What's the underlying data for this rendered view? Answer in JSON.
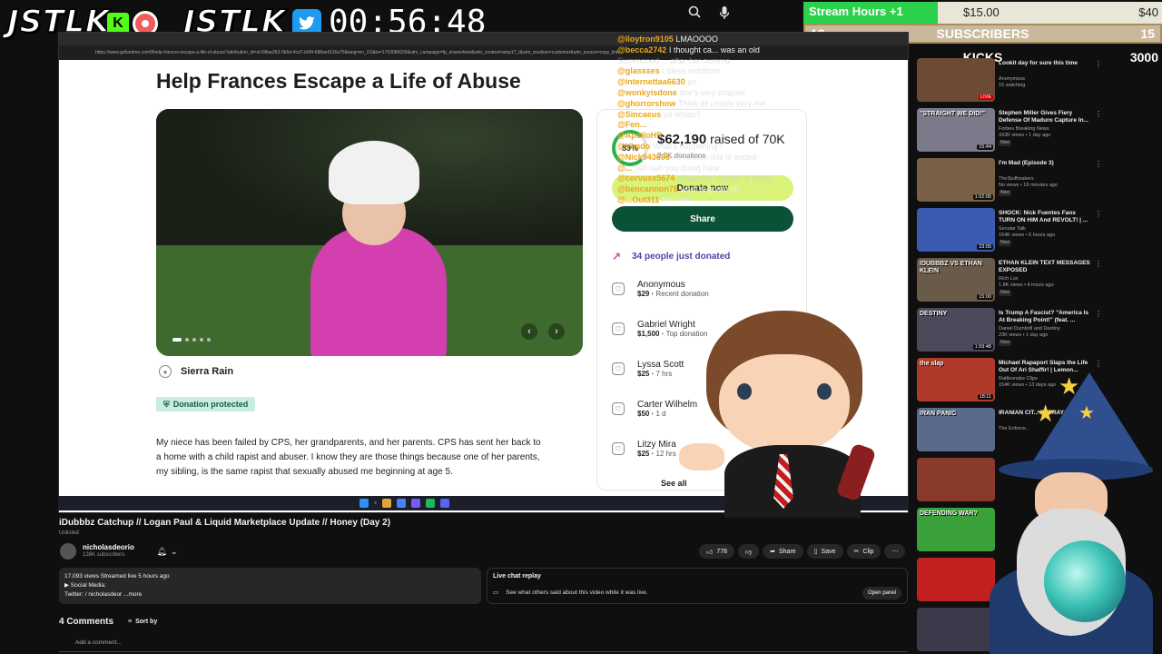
{
  "overlay": {
    "brand_left": "JSTLK",
    "brand_right": "JSTLK",
    "kick_letter": "K",
    "timer": "00:56:48",
    "goal_label": "Stream Hours +1",
    "goal_fraction": 0.375,
    "goal_current": "$15.00",
    "goal_target": "$40",
    "subs_left": "18",
    "subs_center": "SUBSCRIBERS",
    "subs_right": "15",
    "kicks_badge": "0",
    "kicks_center": "KICKS",
    "kicks_right": "3000"
  },
  "browser": {
    "url": "https://www.gofundme.com/f/help-frances-escape-a-life-of-abuse?attribution_id=sl:09faa263-0b5d-4cd7-b0f4-688ae6116a75&lang=en_US&ts=1763084206&utm_campaign=fp_sharesheet&utm_content=amp17_t&utm_medium=customer&utm_source=copy_link"
  },
  "gofundme": {
    "title": "Help Frances Escape a Life of Abuse",
    "organizer": "Sierra Rain",
    "protected_label": "Donation protected",
    "story": "My niece has been failed by CPS, her grandparents, and her parents. CPS has sent her back to a home with a child rapist and abuser. I know they are those things because one of her parents, my sibling, is the same rapist that sexually abused me beginning at age 5.",
    "progress_pct": "89%",
    "raised_amount": "$62,190",
    "raised_of": "raised of 70K",
    "donations_count": "2.9K donations",
    "donate_label": "Donate now",
    "share_label": "Share",
    "recent_label": "34 people just donated",
    "donors": [
      {
        "name": "Anonymous",
        "amount": "$29",
        "note": "Recent donation"
      },
      {
        "name": "Gabriel Wright",
        "amount": "$1,500",
        "note": "Top donation"
      },
      {
        "name": "Lyssa Scott",
        "amount": "$25",
        "note": "7 hrs"
      },
      {
        "name": "Carter Wilhelm",
        "amount": "$50",
        "note": "1 d"
      },
      {
        "name": "Litzy Mira",
        "amount": "$25",
        "note": "12 hrs"
      }
    ],
    "see_all": "See all"
  },
  "chat": [
    {
      "user": "@lloytron9105",
      "msg": "LMAOOOO",
      "dim": false
    },
    {
      "user": "@becca2742",
      "msg": "I thought ca... was an old",
      "dim": false
    },
    {
      "user": "",
      "msg": "Summoned ... after her summa",
      "dim": true
    },
    {
      "user": "@glassses",
      "msg": "I bless redditors",
      "dim": true
    },
    {
      "user": "@internettaa6630",
      "msg": "yo",
      "dim": true
    },
    {
      "user": "@wonkyisdone",
      "msg": "she's very mapset",
      "dim": true
    },
    {
      "user": "@ghorrorshow",
      "msg": "Think all mostly very me",
      "dim": true
    },
    {
      "user": "@Sincaeus",
      "msg": "yo whats?",
      "dim": true
    },
    {
      "user": "@Fen...",
      "msg": "...",
      "dim": true
    },
    {
      "user": "@ApolloHP",
      "msg": "",
      "dim": true
    },
    {
      "user": "@Vlmdo",
      "msg": "What's happening?",
      "dim": true
    },
    {
      "user": "@Nick943898",
      "msg": "no reason this is ended",
      "dim": true
    },
    {
      "user": "@...",
      "msg": "hell nah you doing hare",
      "dim": true
    },
    {
      "user": "@corvusx5674",
      "msg": "Whatever shaese of three",
      "dim": true
    },
    {
      "user": "@bencannon78",
      "msg": "what is going on",
      "dim": false
    },
    {
      "user": "@...Out311",
      "msg": "hell yea",
      "dim": false
    }
  ],
  "video": {
    "title": "iDubbbz Catchup // Logan Paul & Liquid Marketplace Update // Honey (Day 2)",
    "unlisted": "Unlisted",
    "channel": "nicholasdeorio",
    "channel_subs": "138K subscribers",
    "likes": "778",
    "share": "Share",
    "save": "Save",
    "clip": "Clip",
    "desc_line1": "17,093 views  Streamed live 5 hours ago",
    "desc_line2": "▶ Social Media:",
    "desc_line3": "Twitter:  / nicholasdeor  ...more",
    "live_replay_title": "Live chat replay",
    "live_replay_sub": "See what others said about this video while it was live.",
    "open_panel": "Open panel",
    "comments_count": "4 Comments",
    "sort_by": "Sort by",
    "add_comment": "Add a comment..."
  },
  "sidebar": [
    {
      "title": "Lookit day for sure this time",
      "meta1": "Anonymous",
      "meta2": "15 watching",
      "badge": "LIVE",
      "dur": "",
      "color": "#6d4a33"
    },
    {
      "title": "Stephen Miller Gives Fiery Defense Of Maduro Capture In...",
      "meta1": "Forbes Breaking News",
      "meta2": "333K views • 1 day ago",
      "badge": "New",
      "dur": "15:44",
      "color": "#7a7a8a"
    },
    {
      "title": "I'm Mad (Episode 3)",
      "meta1": "TheStuffmakers",
      "meta2": "No views • 19 minutes ago",
      "badge": "New",
      "dur": "1:02:05",
      "color": "#7a6045"
    },
    {
      "title": "SHOCK: Nick Fuentes Fans TURN ON HIM And REVOLT! | ...",
      "meta1": "Secular Talk",
      "meta2": "154K views • 6 hours ago",
      "badge": "New",
      "dur": "23:05",
      "color": "#3a5bb0"
    },
    {
      "title": "ETHAN KLEIN TEXT MESSAGES EXPOSED",
      "meta1": "Rich Lux",
      "meta2": "1.8K views • 4 hours ago",
      "badge": "New",
      "dur": "15:00",
      "color": "#6a5a4a"
    },
    {
      "title": "Is Trump A Fascist? \"America Is At Breaking Point!\" (feat. ...",
      "meta1": "Daniel Dumbrill and Destiny",
      "meta2": "23K views • 1 day ago",
      "badge": "New",
      "dur": "1:59:48",
      "color": "#4a4a5a"
    },
    {
      "title": "Michael Rapaport Slaps the Life Out Of Ari Shaffir! | Lemon...",
      "meta1": "Rattlesnake Clips",
      "meta2": "154K views • 13 days ago",
      "badge": "",
      "dur": "18:11",
      "color": "#b03a2a"
    },
    {
      "title": "IRANIAN CIT... BETRAYAL",
      "meta1": "The Enforce...",
      "meta2": "",
      "badge": "",
      "dur": "",
      "color": "#5a6a8a"
    },
    {
      "title": "",
      "meta1": "",
      "meta2": "",
      "badge": "",
      "dur": "",
      "color": "#8a3a2a"
    },
    {
      "title": "",
      "meta1": "",
      "meta2": "",
      "badge": "",
      "dur": "",
      "color": "#3aa03a"
    },
    {
      "title": "",
      "meta1": "",
      "meta2": "",
      "badge": "",
      "dur": "",
      "color": "#c02020"
    },
    {
      "title": "Hasan Joins the Destiny &",
      "meta1": "",
      "meta2": "",
      "badge": "",
      "dur": "",
      "color": "#3a3a4a"
    }
  ],
  "thumb_texts": {
    "t1": "\"STRAIGHT WE DID!\"",
    "t4": "IDUBBBZ VS ETHAN KLEIN",
    "t5": "DESTINY",
    "t6": "the slap",
    "t7": "IRAN PANIC",
    "t9": "DEFENDING WAR?"
  },
  "colors": {
    "accent_green": "#2bd14a",
    "chat_user": "#e8a71f",
    "gofundme_green": "#0b5136",
    "donate_lime": "#d8f27a"
  }
}
